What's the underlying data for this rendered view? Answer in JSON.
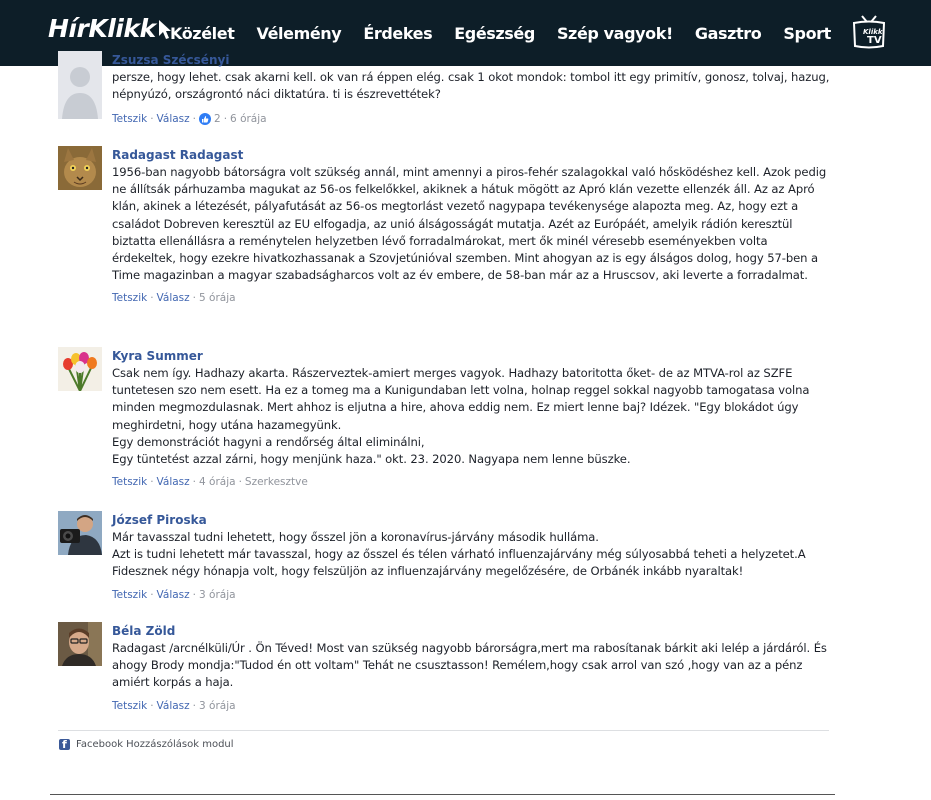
{
  "header": {
    "logo_text": "HírKlikk",
    "nav": [
      "Közélet",
      "Vélemény",
      "Érdekes",
      "Egészség",
      "Szép vagyok!",
      "Gasztro",
      "Sport"
    ],
    "tv_logo_text": "Klikk TV"
  },
  "comments": [
    {
      "name": "Zsuzsa Szécsényi",
      "text": "persze, hogy lehet. csak akarni kell. ok van rá éppen elég. csak 1 okot mondok: tombol itt egy primitív, gonosz, tolvaj, hazug, népnyúzó, országrontó náci diktatúra. ti is észrevettétek?",
      "like": "Tetszik",
      "reply": "Válasz",
      "likes_count": "2",
      "time": "6 órája",
      "edited": ""
    },
    {
      "name": "Radagast Radagast",
      "text": "1956-ban nagyobb bátorságra volt szükség annál, mint amennyi a piros-fehér szalagokkal való hősködéshez kell. Azok pedig ne állítsák párhuzamba magukat az 56-os felkelőkkel, akiknek a hátuk mögött az Apró klán vezette ellenzék áll. Az az Apró klán, akinek a létezését, pályafutását az 56-os megtorlást vezető nagypapa tevékenysége alapozta meg. Az, hogy ezt a családot Dobreven keresztül az EU elfogadja, az unió álságosságát mutatja. Azét az Európáét, amelyik rádión keresztül biztatta ellenállásra a reménytelen helyzetben lévő forradalmárokat, mert ők minél véresebb eseményekben volta érdekeltek, hogy ezekre hivatkozhassanak a Szovjetúnióval szemben. Mint ahogyan az is egy álságos dolog, hogy 57-ben a Time magazinban a magyar szabadságharcos volt az év embere, de 58-ban már az a Hruscsov, aki leverte a forradalmat.",
      "like": "Tetszik",
      "reply": "Válasz",
      "likes_count": "",
      "time": "5 órája",
      "edited": ""
    },
    {
      "name": "Kyra Summer",
      "text": "Csak nem így. Hadhazy akarta. Rászerveztek-amiert merges vagyok. Hadhazy batoritotta őket- de az MTVA-rol az SZFE tuntetesen szo nem esett. Ha ez a tomeg ma a Kunigundaban lett volna, holnap reggel sokkal nagyobb tamogatasa volna minden megmozdulasnak. Mert ahhoz is eljutna a hire, ahova eddig nem. Ez miert lenne baj? Idézek. \"Egy blokádot úgy meghirdetni, hogy utána hazamegyünk.\nEgy demonstrációt hagyni a rendőrség által eliminálni,\nEgy tüntetést azzal zárni, hogy menjünk haza.\" okt. 23. 2020. Nagyapa nem lenne büszke.",
      "like": "Tetszik",
      "reply": "Válasz",
      "likes_count": "",
      "time": "4 órája",
      "edited": "Szerkesztve"
    },
    {
      "name": "József Piroska",
      "text": "Már tavasszal tudni lehetett, hogy ősszel jön a koronavírus-járvány második hulláma.\nAzt is tudni lehetett már tavasszal, hogy az ősszel és télen várható influenzajárvány még súlyosabbá teheti a helyzetet.A Fidesznek négy hónapja volt, hogy felszüljön az influenzajárvány megelőzésére, de Orbánék inkább nyaraltak!",
      "like": "Tetszik",
      "reply": "Válasz",
      "likes_count": "",
      "time": "3 órája",
      "edited": ""
    },
    {
      "name": "Béla Zöld",
      "text": "Radagast /arcnélküli/Úr . Ön Téved! Most van szükség nagyobb bárorságra,mert ma rabosítanak bárkit aki lelép a járdáról. És ahogy Brody mondja:\"Tudod én ott voltam\" Tehát ne csusztasson! Remélem,hogy csak arrol van szó ,hogy van az a pénz amiért korpás a haja.",
      "like": "Tetszik",
      "reply": "Válasz",
      "likes_count": "",
      "time": "3 órája",
      "edited": ""
    }
  ],
  "footer": {
    "plugin_label": "Facebook Hozzászólások modul"
  },
  "colors": {
    "header_bg": "#0d1e28",
    "link": "#365899",
    "meta_link": "#4267b2",
    "like_badge": "#2f7df5"
  }
}
